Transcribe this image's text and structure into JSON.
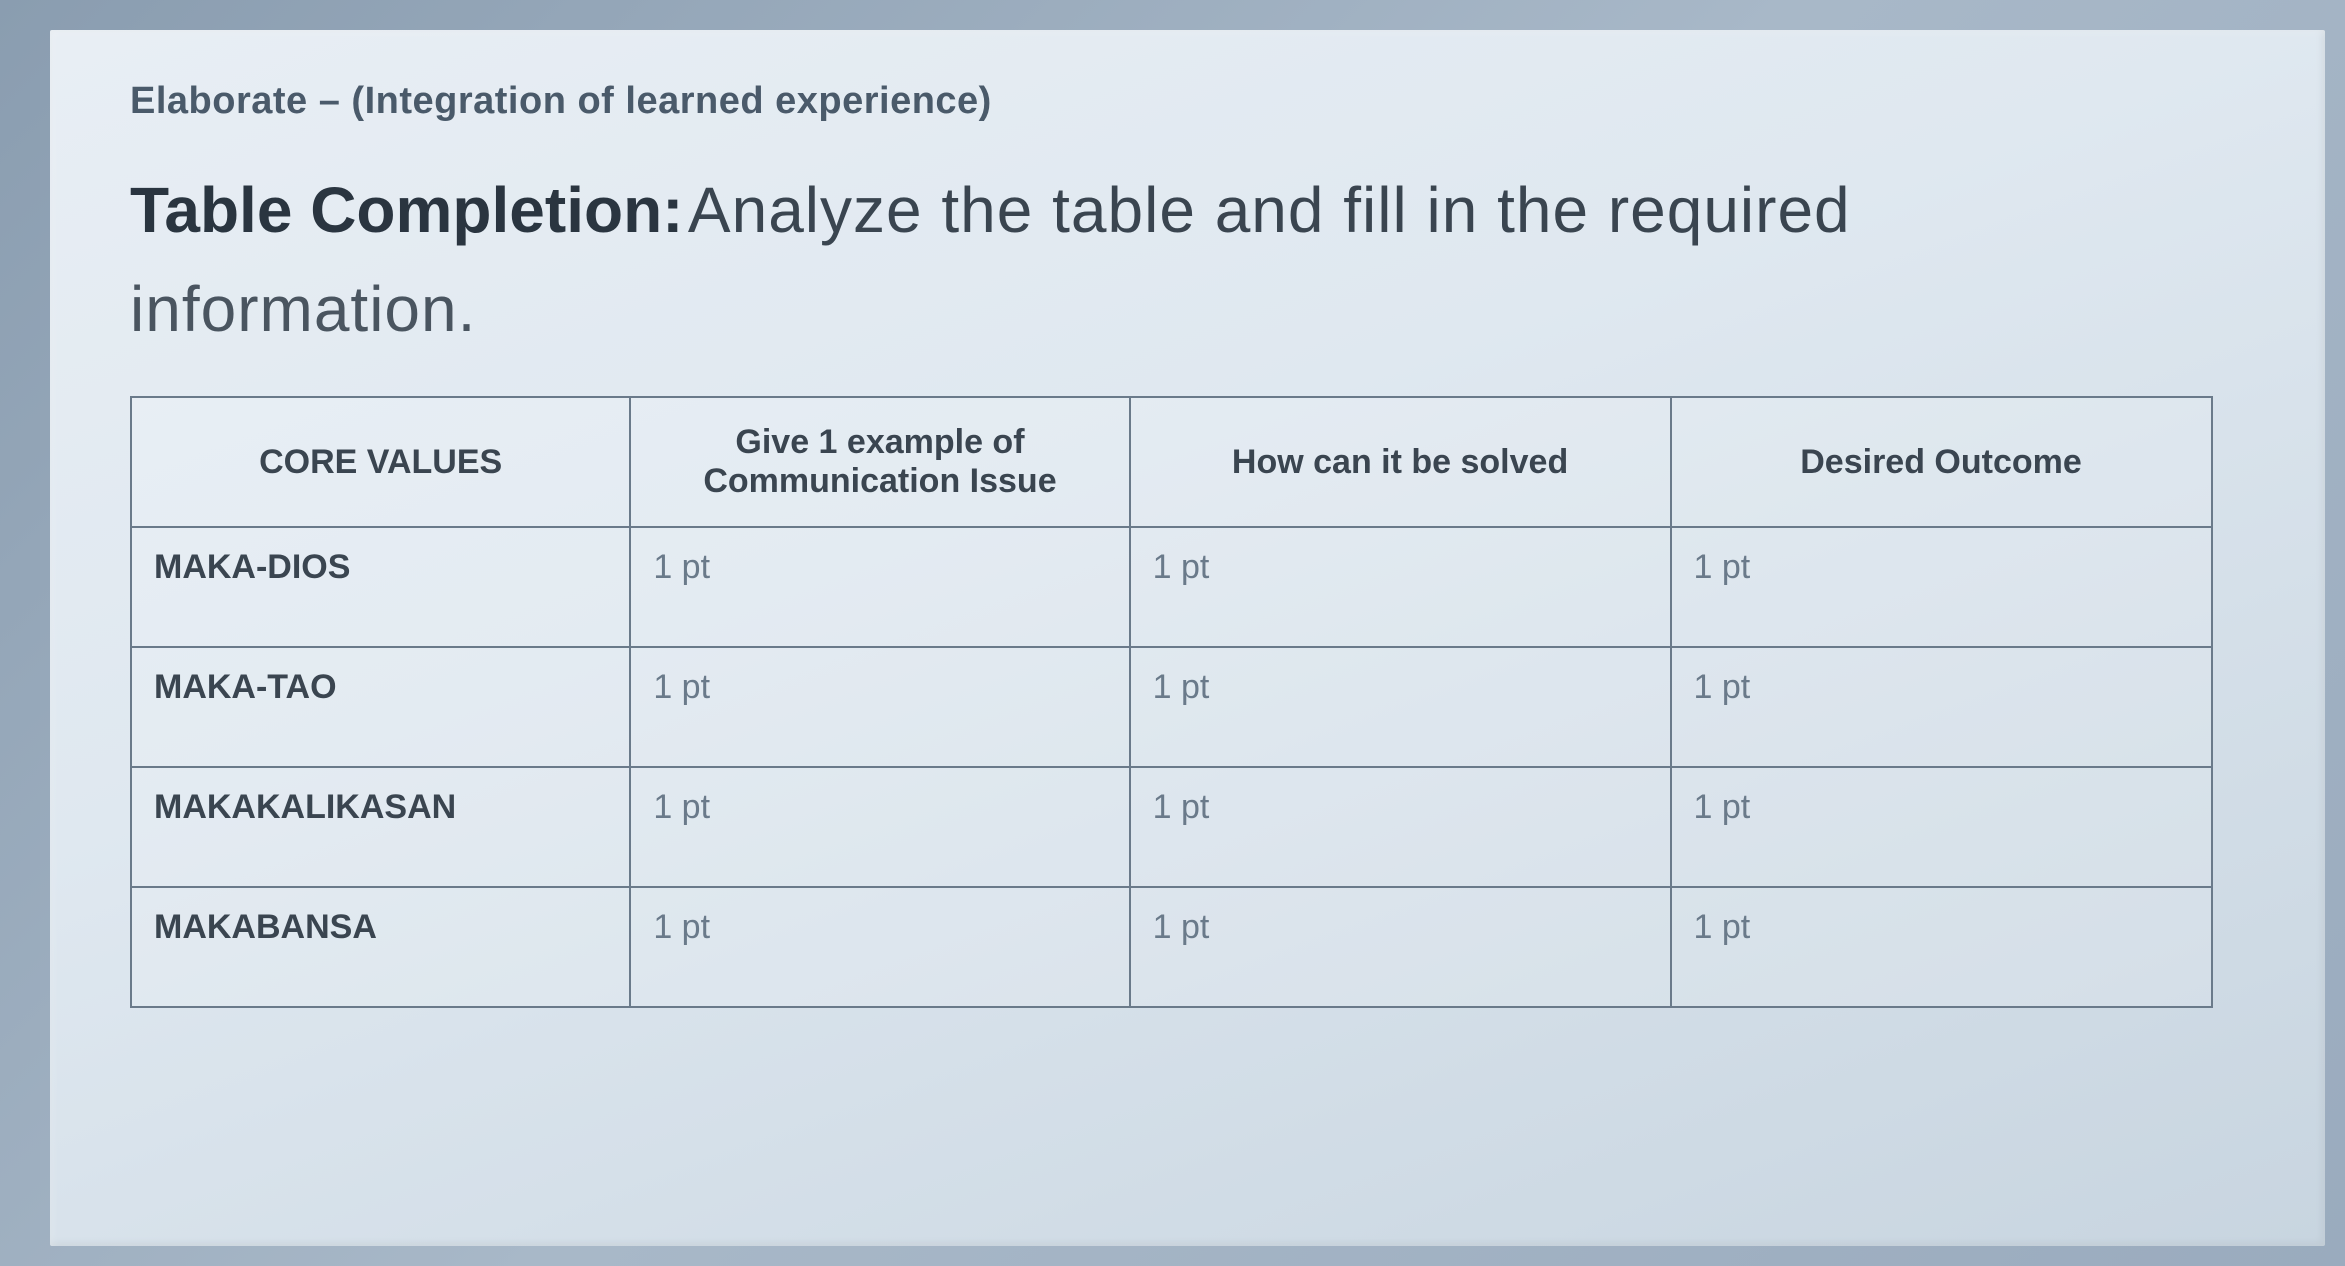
{
  "section_label": "Elaborate – (Integration of learned experience)",
  "title_bold": "Table Completion:",
  "title_rest": " Analyze the table and fill in the required",
  "subtitle": "information.",
  "table": {
    "headers": [
      "CORE VALUES",
      "Give 1 example of Communication Issue",
      "How can it be solved",
      "Desired Outcome"
    ],
    "rows": [
      {
        "label": "MAKA-DIOS",
        "cells": [
          "1 pt",
          "1 pt",
          "1 pt"
        ]
      },
      {
        "label": "MAKA-TAO",
        "cells": [
          "1 pt",
          "1 pt",
          "1 pt"
        ]
      },
      {
        "label": "MAKAKALIKASAN",
        "cells": [
          "1 pt",
          "1 pt",
          "1 pt"
        ]
      },
      {
        "label": "MAKABANSA",
        "cells": [
          "1 pt",
          "1 pt",
          "1 pt"
        ]
      }
    ]
  }
}
